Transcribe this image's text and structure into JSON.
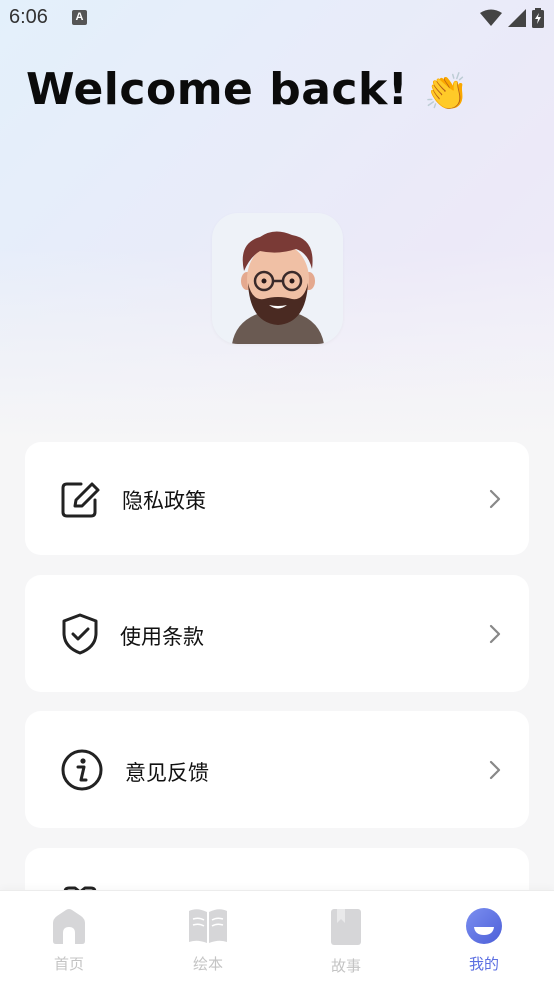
{
  "status_bar": {
    "time": "6:06",
    "notification_icon": "A"
  },
  "header": {
    "welcome_text": "Welcome back!",
    "wave_emoji": "👏"
  },
  "profile": {
    "avatar_icon": "memoji-avatar"
  },
  "menu": {
    "items": [
      {
        "label": "隐私政策",
        "icon": "edit-icon"
      },
      {
        "label": "使用条款",
        "icon": "shield-check-icon"
      },
      {
        "label": "意见反馈",
        "icon": "info-icon"
      }
    ]
  },
  "bottom_nav": {
    "items": [
      {
        "label": "首页",
        "icon": "home-icon",
        "active": false
      },
      {
        "label": "绘本",
        "icon": "book-icon",
        "active": false
      },
      {
        "label": "故事",
        "icon": "story-book-icon",
        "active": false
      },
      {
        "label": "我的",
        "icon": "profile-icon",
        "active": true
      }
    ]
  },
  "colors": {
    "accent": "#5b6ee1",
    "inactive": "#c4c4c4"
  }
}
